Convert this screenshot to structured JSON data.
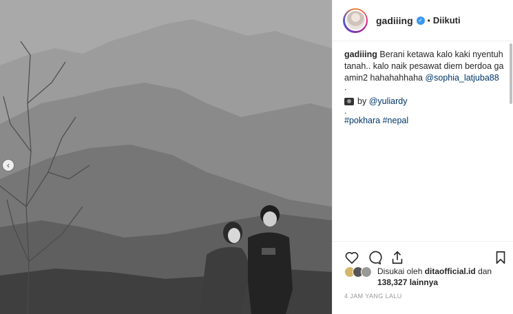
{
  "post": {
    "username": "gadiiing",
    "follow_state": "Diikuti",
    "dot": "•",
    "caption": {
      "user": "gadiiing",
      "text": "Berani ketawa kalo kaki nyentuh tanah.. kalo naik pesawat diem berdoa ga amin2 hahahahhaha ",
      "mention": "@sophia_latjuba88",
      "separator": ".",
      "credit_prefix": "by ",
      "credit_mention": "@yuliardy",
      "hashtags": [
        "#pokhara",
        "#nepal"
      ]
    },
    "likes": {
      "prefix": "Disukai oleh",
      "top_liker": "ditaofficial.id",
      "conjunction": "dan",
      "count_text": "138,327 lainnya"
    },
    "timestamp": "4 JAM YANG LALU"
  },
  "icons": {
    "like": "heart-icon",
    "comment": "comment-icon",
    "share": "share-icon",
    "save": "bookmark-icon",
    "verified": "verified-badge-icon",
    "camera": "camera-icon",
    "carousel_prev": "chevron-left-icon"
  },
  "colors": {
    "link": "#003569",
    "verified": "#3897f0",
    "text": "#262626",
    "muted": "#999999"
  }
}
